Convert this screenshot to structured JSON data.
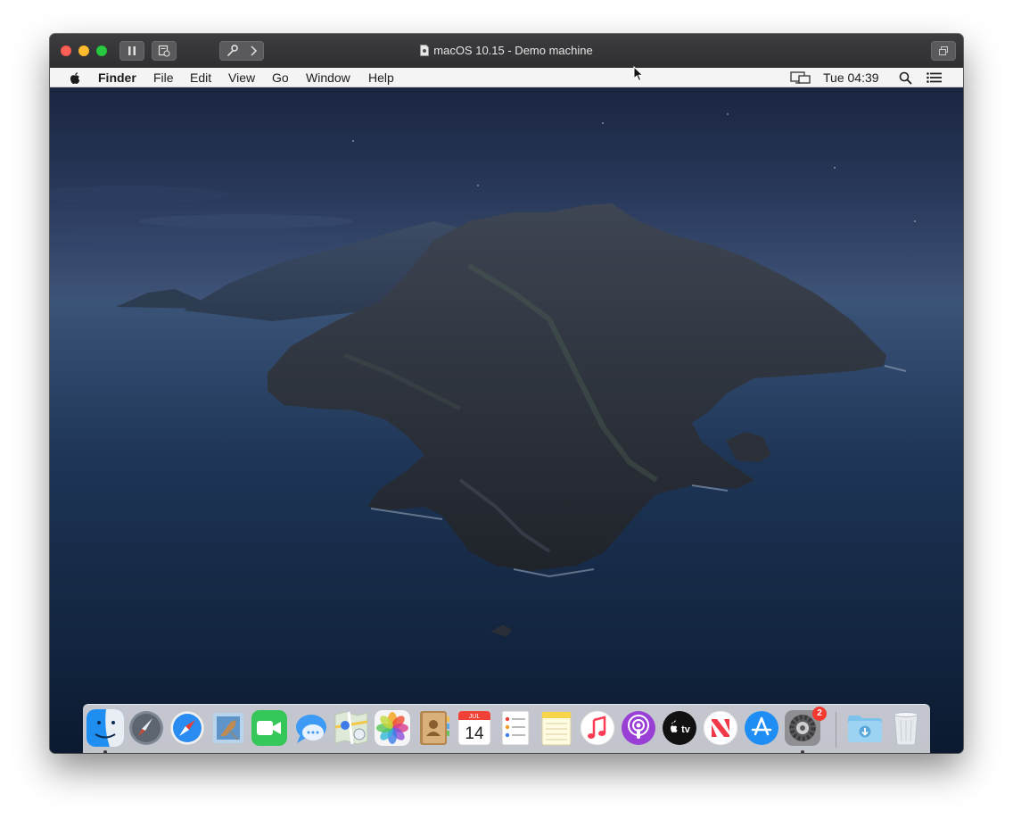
{
  "window": {
    "title": "macOS 10.15 - Demo machine"
  },
  "menubar": {
    "app_name": "Finder",
    "items": [
      "File",
      "Edit",
      "View",
      "Go",
      "Window",
      "Help"
    ],
    "clock": "Tue 04:39"
  },
  "dock": {
    "apps": [
      {
        "name": "Finder",
        "icon": "finder-icon",
        "running": true
      },
      {
        "name": "Launchpad",
        "icon": "launchpad-icon"
      },
      {
        "name": "Safari",
        "icon": "safari-icon"
      },
      {
        "name": "Mail",
        "icon": "mail-icon"
      },
      {
        "name": "FaceTime",
        "icon": "facetime-icon"
      },
      {
        "name": "Messages",
        "icon": "messages-icon"
      },
      {
        "name": "Maps",
        "icon": "maps-icon"
      },
      {
        "name": "Photos",
        "icon": "photos-icon"
      },
      {
        "name": "Contacts",
        "icon": "contacts-icon"
      },
      {
        "name": "Calendar",
        "icon": "calendar-icon",
        "month": "JUL",
        "day": "14"
      },
      {
        "name": "Reminders",
        "icon": "reminders-icon"
      },
      {
        "name": "Notes",
        "icon": "notes-icon"
      },
      {
        "name": "Music",
        "icon": "music-icon"
      },
      {
        "name": "Podcasts",
        "icon": "podcasts-icon"
      },
      {
        "name": "TV",
        "icon": "tv-icon",
        "label": "tv"
      },
      {
        "name": "News",
        "icon": "news-icon"
      },
      {
        "name": "App Store",
        "icon": "app-store-icon"
      },
      {
        "name": "System Preferences",
        "icon": "system-preferences-icon",
        "badge": "2",
        "running": true
      }
    ],
    "others": [
      {
        "name": "Downloads",
        "icon": "downloads-folder-icon"
      },
      {
        "name": "Trash",
        "icon": "trash-icon"
      }
    ]
  },
  "colors": {
    "close": "#fe5f57",
    "minimize": "#febc2e",
    "zoom": "#28c840",
    "badge": "#f4392f",
    "titlebar": "#353537"
  }
}
